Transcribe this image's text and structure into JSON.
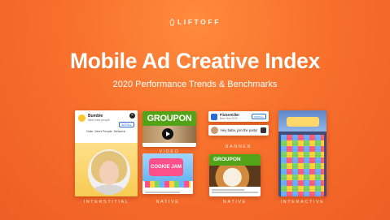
{
  "brand": {
    "name": "LIFTOFF"
  },
  "hero": {
    "title": "Mobile Ad Creative Index",
    "subtitle": "2020 Performance Trends & Benchmarks"
  },
  "creatives": {
    "interstitial": {
      "caption": "INTERSTITIAL",
      "app_name": "Bumble",
      "app_sub": "Meet new people",
      "install": "INSTALL",
      "tagline": "Date. Meet People. Network."
    },
    "video": {
      "caption": "VIDEO",
      "brand": "GROUPON"
    },
    "banner": {
      "caption": "BANNER",
      "app_name": "FlickerKiller",
      "app_sub": "New Year 2020",
      "install": "INSTALL",
      "message": "Hey babe, join the party!"
    },
    "native_game": {
      "caption": "NATIVE",
      "logo": "COOKIE JAM"
    },
    "native_food": {
      "caption": "NATIVE",
      "brand": "GROUPON"
    },
    "interactive": {
      "caption": "INTERACTIVE"
    }
  },
  "colors": {
    "background": "#f8712c",
    "groupon_green": "#53a318",
    "bumble_yellow": "#ffc629"
  }
}
